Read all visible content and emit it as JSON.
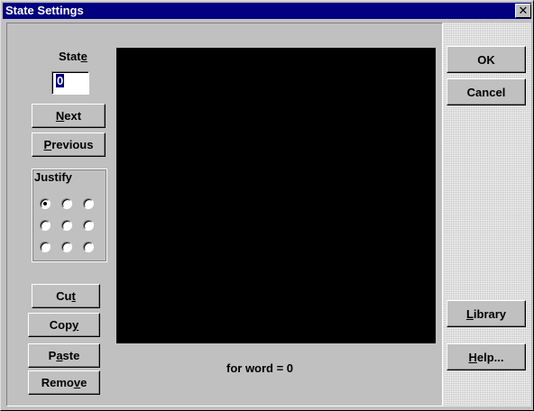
{
  "window": {
    "title": "State Settings",
    "close_glyph": "✕"
  },
  "state": {
    "label_prefix": "Stat",
    "label_mnemonic": "e",
    "label_suffix": "",
    "value": "0"
  },
  "buttons": {
    "next": {
      "pre": "",
      "mn": "N",
      "post": "ext"
    },
    "previous": {
      "pre": "",
      "mn": "P",
      "post": "revious"
    },
    "cut": {
      "pre": "Cu",
      "mn": "t",
      "post": ""
    },
    "copy": {
      "pre": "Cop",
      "mn": "y",
      "post": ""
    },
    "paste": {
      "pre": "P",
      "mn": "a",
      "post": "ste"
    },
    "remove": {
      "pre": "Remo",
      "mn": "v",
      "post": "e"
    },
    "ok": {
      "label": "OK"
    },
    "cancel": {
      "label": "Cancel"
    },
    "library": {
      "pre": "",
      "mn": "L",
      "post": "ibrary"
    },
    "help": {
      "pre": "",
      "mn": "H",
      "post": "elp..."
    }
  },
  "justify": {
    "label": "Justify",
    "selected": "top-left"
  },
  "status": {
    "text": "for word = 0"
  }
}
